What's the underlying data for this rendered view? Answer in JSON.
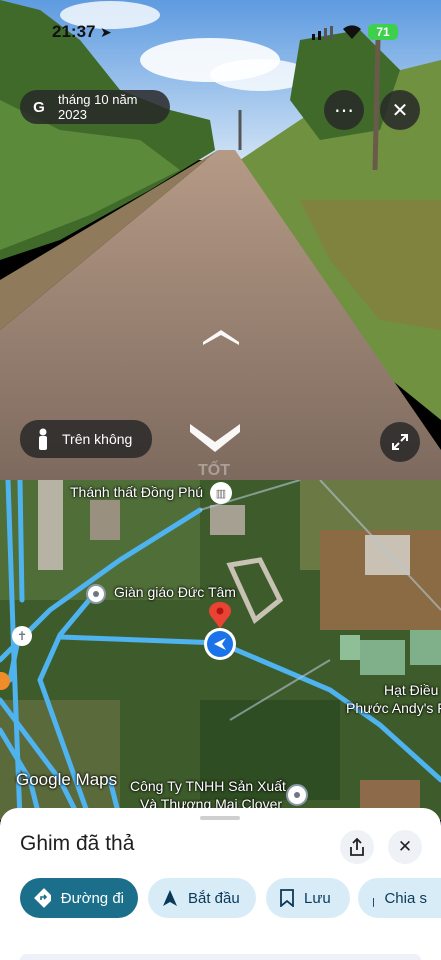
{
  "status_bar": {
    "time": "21:37",
    "battery": "71"
  },
  "street_view": {
    "date_label": "tháng 10 năm 2023",
    "google_letter": "G",
    "more_icon": "more-horizontal-icon",
    "close_icon": "close-icon",
    "aerial_label": "Trên không",
    "watermark": "TỐT"
  },
  "map": {
    "labels": {
      "thanh_that": "Thánh thất Đồng Phú",
      "gian_giao": "Giàn giáo Đức Tâm",
      "hat_dieu_1": "Hạt Điều",
      "hat_dieu_2": "Phước Andy's F",
      "cong_ty_1": "Công Ty TNHH Sản Xuất",
      "cong_ty_2": "Và Thương Mại Clover",
      "logo": "Google Maps"
    }
  },
  "sheet": {
    "title": "Ghim đã thả",
    "actions": [
      {
        "label": "Đường đi",
        "icon": "directions-icon"
      },
      {
        "label": "Bắt đầu",
        "icon": "navigation-arrow-icon"
      },
      {
        "label": "Lưu",
        "icon": "bookmark-icon"
      },
      {
        "label": "Chia s",
        "icon": "share-icon"
      }
    ]
  },
  "colors": {
    "route": "#4fb3f0",
    "primary": "#1b6f8a",
    "chip": "#d8ecf8"
  }
}
